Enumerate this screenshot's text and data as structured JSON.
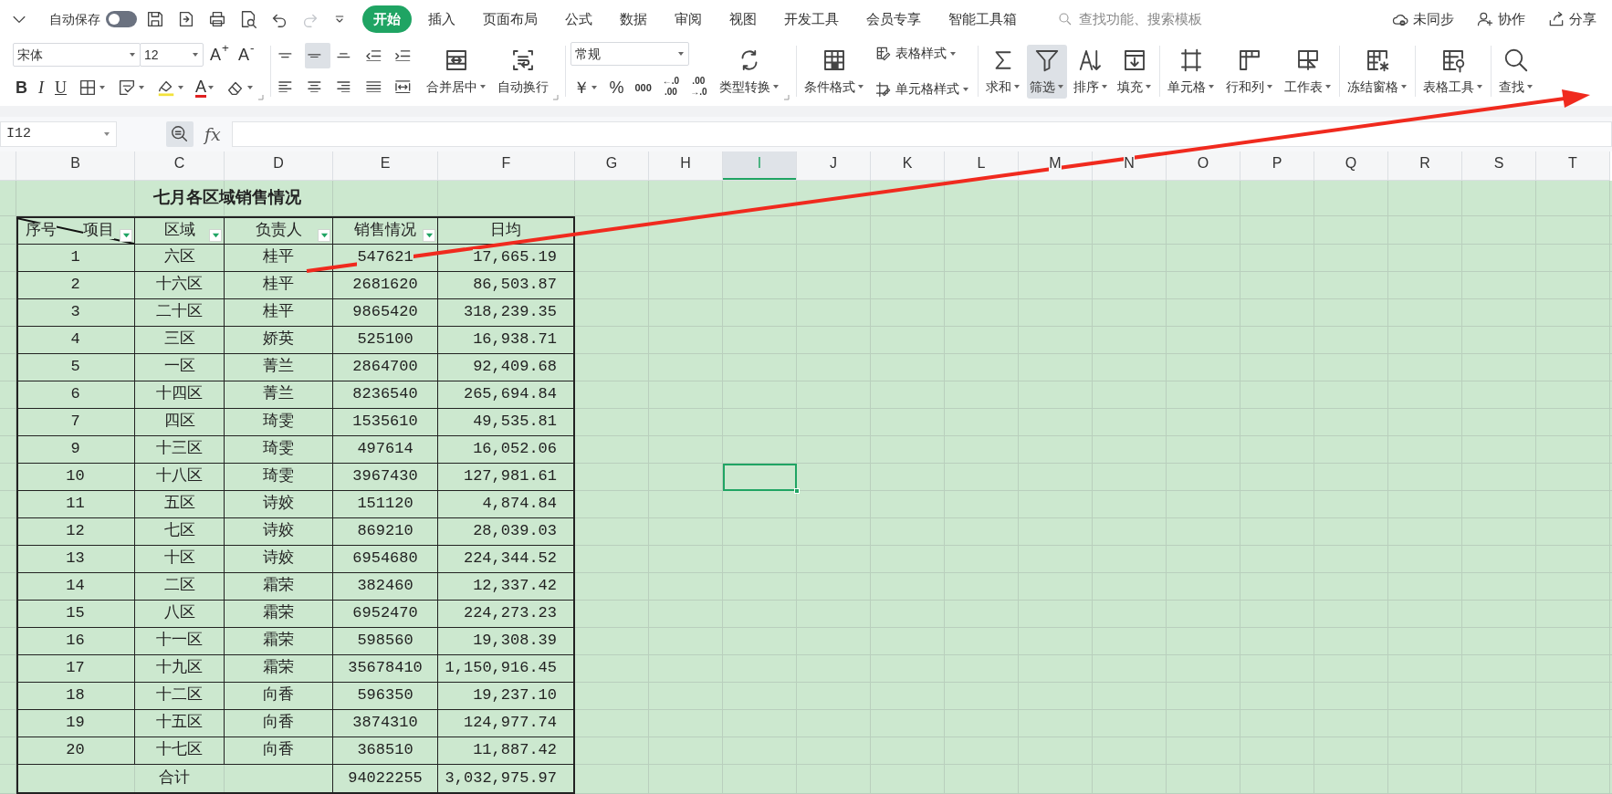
{
  "menu_bar": {
    "autosave_label": "自动保存",
    "autosave_on": false,
    "undo_redo": [
      {
        "disabled": false
      },
      {
        "disabled": true
      }
    ],
    "tabs": [
      {
        "label": "开始",
        "selected": true
      },
      {
        "label": "插入",
        "selected": false
      },
      {
        "label": "页面布局",
        "selected": false
      },
      {
        "label": "公式",
        "selected": false
      },
      {
        "label": "数据",
        "selected": false
      },
      {
        "label": "审阅",
        "selected": false
      },
      {
        "label": "视图",
        "selected": false
      },
      {
        "label": "开发工具",
        "selected": false
      },
      {
        "label": "会员专享",
        "selected": false
      },
      {
        "label": "智能工具箱",
        "selected": false
      }
    ],
    "search": {
      "placeholder": "查找功能、搜索模板"
    },
    "right_actions": [
      "未同步",
      "协作",
      "分享"
    ]
  },
  "ribbon": {
    "font_name": "宋体",
    "font_size": "12",
    "size_buttons": [
      "A$^{+}$",
      "A$^{-}$"
    ],
    "style_buttons": [
      "B",
      "I",
      "U"
    ],
    "font_color_label": "A",
    "align_buttons": [
      {
        "selected": false
      },
      {
        "selected": true
      },
      {
        "selected": false
      },
      {
        "selected": false
      },
      {
        "selected": false
      },
      {
        "selected": false
      },
      {
        "selected": false
      },
      {
        "selected": false
      },
      {
        "selected": false
      },
      {
        "selected": false
      }
    ],
    "merge_buttons": [
      {
        "label": "合并居中",
        "dropdown": true,
        "active": false
      },
      {
        "label": "自动换行",
        "dropdown": false,
        "active": false
      }
    ],
    "number_format": "常规",
    "number_buttons": [
      "￥",
      "%",
      "000"
    ],
    "decimal_buttons": [
      [
        "←.0",
        ".00"
      ],
      [
        ".00",
        "→.0"
      ]
    ],
    "convert_button": {
      "label": "类型转换",
      "dropdown": true,
      "active": false
    },
    "style_group": [
      {
        "label": "条件格式",
        "dropdown": true,
        "active": false
      }
    ],
    "style_small": [
      "表格样式",
      "单元格样式"
    ],
    "edit_buttons": [
      {
        "label": "求和",
        "dropdown": true,
        "active": false
      },
      {
        "label": "筛选",
        "dropdown": true,
        "active": true
      },
      {
        "label": "排序",
        "dropdown": true,
        "active": false
      },
      {
        "label": "填充",
        "dropdown": true,
        "active": false
      }
    ],
    "cell_buttons": [
      {
        "label": "单元格",
        "dropdown": true,
        "active": false
      },
      {
        "label": "行和列",
        "dropdown": true,
        "active": false
      },
      {
        "label": "工作表",
        "dropdown": true,
        "active": false
      }
    ],
    "tail_buttons": [
      {
        "label": "冻结窗格",
        "dropdown": true,
        "active": false
      },
      {
        "label": "表格工具",
        "dropdown": true,
        "active": false
      },
      {
        "label": "查找",
        "dropdown": true,
        "active": false
      }
    ]
  },
  "formula_bar": {
    "name_box": "I12",
    "fx": "fx"
  },
  "sheet": {
    "columns": [
      {
        "label": "B",
        "selected": false
      },
      {
        "label": "C",
        "selected": false
      },
      {
        "label": "D",
        "selected": false
      },
      {
        "label": "E",
        "selected": false
      },
      {
        "label": "F",
        "selected": false
      },
      {
        "label": "G",
        "selected": false
      },
      {
        "label": "H",
        "selected": false
      },
      {
        "label": "I",
        "selected": true
      },
      {
        "label": "J",
        "selected": false
      },
      {
        "label": "K",
        "selected": false
      },
      {
        "label": "L",
        "selected": false
      },
      {
        "label": "M",
        "selected": false
      },
      {
        "label": "N",
        "selected": false
      },
      {
        "label": "O",
        "selected": false
      },
      {
        "label": "P",
        "selected": false
      },
      {
        "label": "Q",
        "selected": false
      },
      {
        "label": "R",
        "selected": false
      },
      {
        "label": "S",
        "selected": false
      },
      {
        "label": "T",
        "selected": false
      }
    ],
    "title": "七月各区域销售情况",
    "header": [
      {
        "label": "序号",
        "label_2": "项目",
        "diagonal": true,
        "filter": true
      },
      {
        "label": "区域",
        "diagonal": false,
        "filter": true
      },
      {
        "label": "负责人",
        "diagonal": false,
        "filter": true
      },
      {
        "label": "销售情况",
        "diagonal": false,
        "filter": true
      },
      {
        "label": "日均",
        "diagonal": false,
        "filter": false
      }
    ],
    "rows": [
      {
        "no": "1",
        "region": "六区",
        "owner": "桂平",
        "sales": "547621",
        "daily": "17,665.19",
        "selected": false
      },
      {
        "no": "2",
        "region": "十六区",
        "owner": "桂平",
        "sales": "2681620",
        "daily": "86,503.87",
        "selected": false
      },
      {
        "no": "3",
        "region": "二十区",
        "owner": "桂平",
        "sales": "9865420",
        "daily": "318,239.35",
        "selected": false
      },
      {
        "no": "4",
        "region": "三区",
        "owner": "娇英",
        "sales": "525100",
        "daily": "16,938.71",
        "selected": false
      },
      {
        "no": "5",
        "region": "一区",
        "owner": "菁兰",
        "sales": "2864700",
        "daily": "92,409.68",
        "selected": false
      },
      {
        "no": "6",
        "region": "十四区",
        "owner": "菁兰",
        "sales": "8236540",
        "daily": "265,694.84",
        "selected": false
      },
      {
        "no": "7",
        "region": "四区",
        "owner": "琦雯",
        "sales": "1535610",
        "daily": "49,535.81",
        "selected": false
      },
      {
        "no": "9",
        "region": "十三区",
        "owner": "琦雯",
        "sales": "497614",
        "daily": "16,052.06",
        "selected": false
      },
      {
        "no": "10",
        "region": "十八区",
        "owner": "琦雯",
        "sales": "3967430",
        "daily": "127,981.61",
        "selected": true
      },
      {
        "no": "11",
        "region": "五区",
        "owner": "诗姣",
        "sales": "151120",
        "daily": "4,874.84",
        "selected": false
      },
      {
        "no": "12",
        "region": "七区",
        "owner": "诗姣",
        "sales": "869210",
        "daily": "28,039.03",
        "selected": false
      },
      {
        "no": "13",
        "region": "十区",
        "owner": "诗姣",
        "sales": "6954680",
        "daily": "224,344.52",
        "selected": false
      },
      {
        "no": "14",
        "region": "二区",
        "owner": "霜荣",
        "sales": "382460",
        "daily": "12,337.42",
        "selected": false
      },
      {
        "no": "15",
        "region": "八区",
        "owner": "霜荣",
        "sales": "6952470",
        "daily": "224,273.23",
        "selected": false
      },
      {
        "no": "16",
        "region": "十一区",
        "owner": "霜荣",
        "sales": "598560",
        "daily": "19,308.39",
        "selected": false
      },
      {
        "no": "17",
        "region": "十九区",
        "owner": "霜荣",
        "sales": "35678410",
        "daily": "1,150,916.45",
        "selected": false
      },
      {
        "no": "18",
        "region": "十二区",
        "owner": "向香",
        "sales": "596350",
        "daily": "19,237.10",
        "selected": false
      },
      {
        "no": "19",
        "region": "十五区",
        "owner": "向香",
        "sales": "3874310",
        "daily": "124,977.74",
        "selected": false
      },
      {
        "no": "20",
        "region": "十七区",
        "owner": "向香",
        "sales": "368510",
        "daily": "11,887.42",
        "selected": false
      }
    ],
    "total": {
      "label": "合计",
      "sales": "94022255",
      "daily": "3,032,975.97"
    }
  }
}
